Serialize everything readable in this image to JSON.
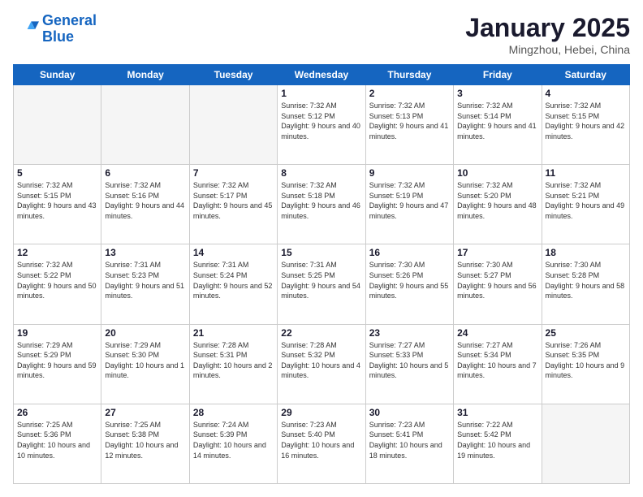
{
  "logo": {
    "line1": "General",
    "line2": "Blue"
  },
  "title": "January 2025",
  "subtitle": "Mingzhou, Hebei, China",
  "days_of_week": [
    "Sunday",
    "Monday",
    "Tuesday",
    "Wednesday",
    "Thursday",
    "Friday",
    "Saturday"
  ],
  "weeks": [
    [
      {
        "day": "",
        "info": ""
      },
      {
        "day": "",
        "info": ""
      },
      {
        "day": "",
        "info": ""
      },
      {
        "day": "1",
        "info": "Sunrise: 7:32 AM\nSunset: 5:12 PM\nDaylight: 9 hours\nand 40 minutes."
      },
      {
        "day": "2",
        "info": "Sunrise: 7:32 AM\nSunset: 5:13 PM\nDaylight: 9 hours\nand 41 minutes."
      },
      {
        "day": "3",
        "info": "Sunrise: 7:32 AM\nSunset: 5:14 PM\nDaylight: 9 hours\nand 41 minutes."
      },
      {
        "day": "4",
        "info": "Sunrise: 7:32 AM\nSunset: 5:15 PM\nDaylight: 9 hours\nand 42 minutes."
      }
    ],
    [
      {
        "day": "5",
        "info": "Sunrise: 7:32 AM\nSunset: 5:15 PM\nDaylight: 9 hours\nand 43 minutes."
      },
      {
        "day": "6",
        "info": "Sunrise: 7:32 AM\nSunset: 5:16 PM\nDaylight: 9 hours\nand 44 minutes."
      },
      {
        "day": "7",
        "info": "Sunrise: 7:32 AM\nSunset: 5:17 PM\nDaylight: 9 hours\nand 45 minutes."
      },
      {
        "day": "8",
        "info": "Sunrise: 7:32 AM\nSunset: 5:18 PM\nDaylight: 9 hours\nand 46 minutes."
      },
      {
        "day": "9",
        "info": "Sunrise: 7:32 AM\nSunset: 5:19 PM\nDaylight: 9 hours\nand 47 minutes."
      },
      {
        "day": "10",
        "info": "Sunrise: 7:32 AM\nSunset: 5:20 PM\nDaylight: 9 hours\nand 48 minutes."
      },
      {
        "day": "11",
        "info": "Sunrise: 7:32 AM\nSunset: 5:21 PM\nDaylight: 9 hours\nand 49 minutes."
      }
    ],
    [
      {
        "day": "12",
        "info": "Sunrise: 7:32 AM\nSunset: 5:22 PM\nDaylight: 9 hours\nand 50 minutes."
      },
      {
        "day": "13",
        "info": "Sunrise: 7:31 AM\nSunset: 5:23 PM\nDaylight: 9 hours\nand 51 minutes."
      },
      {
        "day": "14",
        "info": "Sunrise: 7:31 AM\nSunset: 5:24 PM\nDaylight: 9 hours\nand 52 minutes."
      },
      {
        "day": "15",
        "info": "Sunrise: 7:31 AM\nSunset: 5:25 PM\nDaylight: 9 hours\nand 54 minutes."
      },
      {
        "day": "16",
        "info": "Sunrise: 7:30 AM\nSunset: 5:26 PM\nDaylight: 9 hours\nand 55 minutes."
      },
      {
        "day": "17",
        "info": "Sunrise: 7:30 AM\nSunset: 5:27 PM\nDaylight: 9 hours\nand 56 minutes."
      },
      {
        "day": "18",
        "info": "Sunrise: 7:30 AM\nSunset: 5:28 PM\nDaylight: 9 hours\nand 58 minutes."
      }
    ],
    [
      {
        "day": "19",
        "info": "Sunrise: 7:29 AM\nSunset: 5:29 PM\nDaylight: 9 hours\nand 59 minutes."
      },
      {
        "day": "20",
        "info": "Sunrise: 7:29 AM\nSunset: 5:30 PM\nDaylight: 10 hours\nand 1 minute."
      },
      {
        "day": "21",
        "info": "Sunrise: 7:28 AM\nSunset: 5:31 PM\nDaylight: 10 hours\nand 2 minutes."
      },
      {
        "day": "22",
        "info": "Sunrise: 7:28 AM\nSunset: 5:32 PM\nDaylight: 10 hours\nand 4 minutes."
      },
      {
        "day": "23",
        "info": "Sunrise: 7:27 AM\nSunset: 5:33 PM\nDaylight: 10 hours\nand 5 minutes."
      },
      {
        "day": "24",
        "info": "Sunrise: 7:27 AM\nSunset: 5:34 PM\nDaylight: 10 hours\nand 7 minutes."
      },
      {
        "day": "25",
        "info": "Sunrise: 7:26 AM\nSunset: 5:35 PM\nDaylight: 10 hours\nand 9 minutes."
      }
    ],
    [
      {
        "day": "26",
        "info": "Sunrise: 7:25 AM\nSunset: 5:36 PM\nDaylight: 10 hours\nand 10 minutes."
      },
      {
        "day": "27",
        "info": "Sunrise: 7:25 AM\nSunset: 5:38 PM\nDaylight: 10 hours\nand 12 minutes."
      },
      {
        "day": "28",
        "info": "Sunrise: 7:24 AM\nSunset: 5:39 PM\nDaylight: 10 hours\nand 14 minutes."
      },
      {
        "day": "29",
        "info": "Sunrise: 7:23 AM\nSunset: 5:40 PM\nDaylight: 10 hours\nand 16 minutes."
      },
      {
        "day": "30",
        "info": "Sunrise: 7:23 AM\nSunset: 5:41 PM\nDaylight: 10 hours\nand 18 minutes."
      },
      {
        "day": "31",
        "info": "Sunrise: 7:22 AM\nSunset: 5:42 PM\nDaylight: 10 hours\nand 19 minutes."
      },
      {
        "day": "",
        "info": ""
      }
    ]
  ]
}
